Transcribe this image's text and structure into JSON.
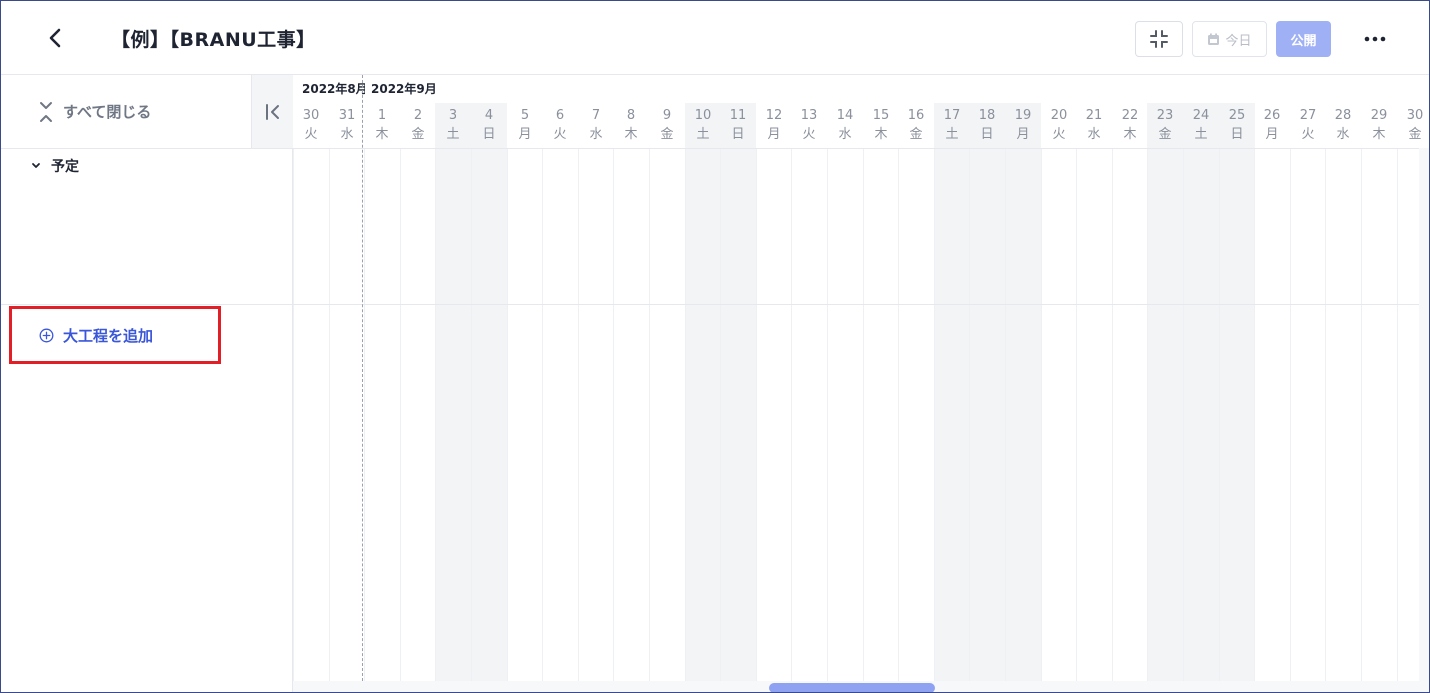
{
  "header": {
    "title": "【例】【BRANU工事】",
    "today_label": "今日",
    "publish_label": "公開",
    "more_label": "•••"
  },
  "sidebar": {
    "collapse_all_label": "すべて閉じる",
    "group_label": "予定",
    "add_process_label": "大工程を追加"
  },
  "timeline": {
    "months": [
      "2022年8月",
      "2022年9月"
    ],
    "days": [
      {
        "d": "30",
        "w": "火",
        "weekend": false
      },
      {
        "d": "31",
        "w": "水",
        "weekend": false
      },
      {
        "d": "1",
        "w": "木",
        "weekend": false
      },
      {
        "d": "2",
        "w": "金",
        "weekend": false
      },
      {
        "d": "3",
        "w": "土",
        "weekend": true
      },
      {
        "d": "4",
        "w": "日",
        "weekend": true
      },
      {
        "d": "5",
        "w": "月",
        "weekend": false
      },
      {
        "d": "6",
        "w": "火",
        "weekend": false
      },
      {
        "d": "7",
        "w": "水",
        "weekend": false
      },
      {
        "d": "8",
        "w": "木",
        "weekend": false
      },
      {
        "d": "9",
        "w": "金",
        "weekend": false
      },
      {
        "d": "10",
        "w": "土",
        "weekend": true
      },
      {
        "d": "11",
        "w": "日",
        "weekend": true
      },
      {
        "d": "12",
        "w": "月",
        "weekend": false
      },
      {
        "d": "13",
        "w": "火",
        "weekend": false
      },
      {
        "d": "14",
        "w": "水",
        "weekend": false
      },
      {
        "d": "15",
        "w": "木",
        "weekend": false
      },
      {
        "d": "16",
        "w": "金",
        "weekend": false
      },
      {
        "d": "17",
        "w": "土",
        "weekend": true
      },
      {
        "d": "18",
        "w": "日",
        "weekend": true
      },
      {
        "d": "19",
        "w": "月",
        "weekend": true
      },
      {
        "d": "20",
        "w": "火",
        "weekend": false
      },
      {
        "d": "21",
        "w": "水",
        "weekend": false
      },
      {
        "d": "22",
        "w": "木",
        "weekend": false
      },
      {
        "d": "23",
        "w": "金",
        "weekend": true
      },
      {
        "d": "24",
        "w": "土",
        "weekend": true
      },
      {
        "d": "25",
        "w": "日",
        "weekend": true
      },
      {
        "d": "26",
        "w": "月",
        "weekend": false
      },
      {
        "d": "27",
        "w": "火",
        "weekend": false
      },
      {
        "d": "28",
        "w": "水",
        "weekend": false
      },
      {
        "d": "29",
        "w": "木",
        "weekend": false
      },
      {
        "d": "30",
        "w": "金",
        "weekend": false
      }
    ]
  },
  "colors": {
    "accent": "#3a56d9",
    "publish_bg": "#9fb0f5",
    "highlight": "#e21f26",
    "weekend_bg": "#f3f4f6"
  },
  "icons": {
    "back": "chevron-left-icon",
    "collapse": "compress-icon",
    "today": "calendar-icon",
    "more": "more-horizontal-icon",
    "collapse_all": "collapse-vertical-icon",
    "sidebar_toggle": "collapse-left-icon",
    "group": "chevron-down-icon",
    "add": "plus-circle-icon"
  }
}
